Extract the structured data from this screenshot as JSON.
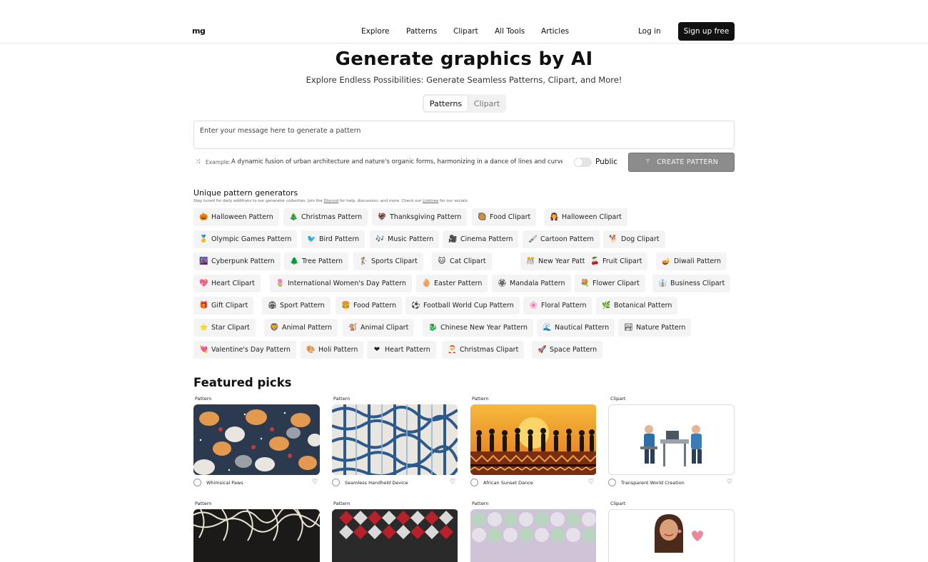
{
  "header": {
    "logo": "mg",
    "nav": [
      "Explore",
      "Patterns",
      "Clipart",
      "All Tools",
      "Articles"
    ],
    "login": "Log in",
    "signup": "Sign up free"
  },
  "hero": {
    "title": "Generate graphics by AI",
    "subtitle": "Explore Endless Possibilities: Generate Seamless Patterns, Clipart, and More!",
    "tabs": [
      "Patterns",
      "Clipart"
    ],
    "active_tab": "Patterns",
    "prompt_placeholder": "Enter your message here to generate a pattern",
    "example_label": "Example:",
    "example_text": "A dynamic fusion of urban architecture and nature's organic forms, harmonizing in a dance of lines and curves, ev",
    "public_label": "Public",
    "public_on": false,
    "create_button": "CREATE PATTERN"
  },
  "generators": {
    "title": "Unique pattern generators",
    "note_parts": [
      "Stay tuned for daily additions to our generator collection. Join the ",
      "Discord",
      " for help, discussion, and more. Check our ",
      "Linktree",
      " for our socials."
    ],
    "chips": [
      {
        "icon": "🎃",
        "label": "Halloween Pattern"
      },
      {
        "icon": "🎄",
        "label": "Christmas Pattern"
      },
      {
        "icon": "🦃",
        "label": "Thanksgiving Pattern"
      },
      {
        "icon": "🥘",
        "label": "Food Clipart"
      },
      {
        "icon": "🧛",
        "label": "Halloween Clipart"
      },
      {
        "icon": "🥇",
        "label": "Olympic Games Pattern"
      },
      {
        "icon": "🐦",
        "label": "Bird Pattern"
      },
      {
        "icon": "🎶",
        "label": "Music Pattern"
      },
      {
        "icon": "🎥",
        "label": "Cinema Pattern"
      },
      {
        "icon": "🖌",
        "label": "Cartoon Pattern"
      },
      {
        "icon": "🐕",
        "label": "Dog Clipart"
      },
      {
        "icon": "🌆",
        "label": "Cyberpunk Pattern"
      },
      {
        "icon": "🌲",
        "label": "Tree Pattern"
      },
      {
        "icon": "🏌",
        "label": "Sports Clipart"
      },
      {
        "icon": "🐱",
        "label": "Cat Clipart"
      },
      {
        "icon": "🎊",
        "label": "New Year Pattern"
      },
      {
        "icon": "🍒",
        "label": "Fruit Clipart"
      },
      {
        "icon": "🪔",
        "label": "Diwali Pattern"
      },
      {
        "icon": "💖",
        "label": "Heart Clipart"
      },
      {
        "icon": "🌷",
        "label": "International Women's Day Pattern"
      },
      {
        "icon": "🥚",
        "label": "Easter Pattern"
      },
      {
        "icon": "🏵",
        "label": "Mandala Pattern"
      },
      {
        "icon": "💐",
        "label": "Flower Clipart"
      },
      {
        "icon": "👔",
        "label": "Business Clipart"
      },
      {
        "icon": "🎁",
        "label": "Gift Clipart"
      },
      {
        "icon": "🏟",
        "label": "Sport Pattern"
      },
      {
        "icon": "🍔",
        "label": "Food Pattern"
      },
      {
        "icon": "⚽",
        "label": "Football World Cup Pattern"
      },
      {
        "icon": "🌸",
        "label": "Floral Pattern"
      },
      {
        "icon": "🌿",
        "label": "Botanical Pattern"
      },
      {
        "icon": "⭐",
        "label": "Star Clipart"
      },
      {
        "icon": "🦁",
        "label": "Animal Pattern"
      },
      {
        "icon": "🐒",
        "label": "Animal Clipart"
      },
      {
        "icon": "🐉",
        "label": "Chinese New Year Pattern"
      },
      {
        "icon": "🌊",
        "label": "Nautical Pattern"
      },
      {
        "icon": "🏞",
        "label": "Nature Pattern"
      },
      {
        "icon": "💘",
        "label": "Valentine's Day Pattern"
      },
      {
        "icon": "🎨",
        "label": "Holi Pattern"
      },
      {
        "icon": "❤",
        "label": "Heart Pattern"
      },
      {
        "icon": "🎅",
        "label": "Christmas Clipart"
      },
      {
        "icon": "🚀",
        "label": "Space Pattern"
      }
    ]
  },
  "featured": {
    "title": "Featured picks",
    "cards": [
      {
        "type": "Pattern",
        "name": "Whimsical Paws",
        "image": "cats-pattern"
      },
      {
        "type": "Pattern",
        "name": "Seamless Handheld Device",
        "image": "blue-device-pattern"
      },
      {
        "type": "Pattern",
        "name": "African Sunset Dance",
        "image": "sunset-dance-pattern"
      },
      {
        "type": "Clipart",
        "name": "Transparent World Creation",
        "image": "office-clipart"
      },
      {
        "type": "Pattern",
        "name": "",
        "image": "tangle-pattern"
      },
      {
        "type": "Pattern",
        "name": "",
        "image": "red-diamond-pattern"
      },
      {
        "type": "Pattern",
        "name": "",
        "image": "pastel-circles-pattern"
      },
      {
        "type": "Clipart",
        "name": "",
        "image": "woman-heart-clipart"
      }
    ]
  }
}
